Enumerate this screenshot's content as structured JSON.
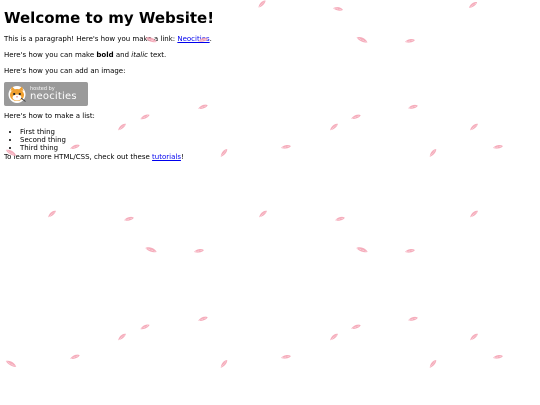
{
  "title": "Welcome to my Website!",
  "para_link": {
    "before": "This is a paragraph! Here's how you make a link: ",
    "link": "Neocities",
    "after": "."
  },
  "para_format": {
    "before": "Here's how you can make ",
    "bold": "bold",
    "middle": " and ",
    "italic": "italic",
    "after": " text."
  },
  "para_image": "Here's how you can add an image:",
  "badge": {
    "hosted": "hosted by",
    "brand": "neocities"
  },
  "list_intro": "Here's how to make a list:",
  "list_items": [
    "First thing",
    "Second thing",
    "Third thing"
  ],
  "footer": {
    "before": "To learn more HTML/CSS, check out these ",
    "link": "tutorials",
    "after": "!"
  },
  "colors": {
    "text": "#000000",
    "link": "#0000ee",
    "petal": "#f4a3b4",
    "badge_bg": "#9a9a9a"
  },
  "icons": {
    "badge_logo": "neocities-cat-icon",
    "background": "petal-icon"
  }
}
